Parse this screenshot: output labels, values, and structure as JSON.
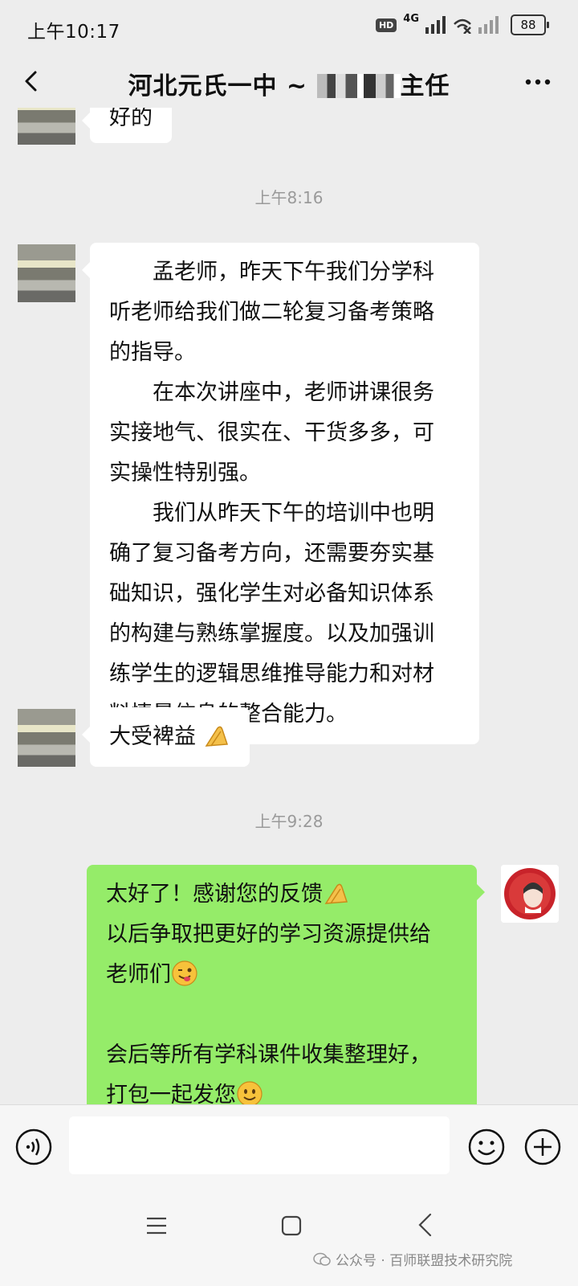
{
  "status_bar": {
    "time": "上午10:17",
    "hd": "HD",
    "network": "4G",
    "battery": "88"
  },
  "header": {
    "title_prefix": "河北元氏一中 ~",
    "title_suffix": "主任"
  },
  "messages": {
    "m0_text": "好的",
    "ts1": "上午8:16",
    "m1_p1": "　　孟老师，昨天下午我们分学科\n听老师给我们做二轮复习备考策略\n的指导。",
    "m1_p2": "　　在本次讲座中，老师讲课很务\n实接地气、很实在、干货多多，可\n实操性特别强。",
    "m1_p3": "　　我们从昨天下午的培训中也明\n确了复习备考方向，还需要夯实基\n础知识，强化学生对必备知识体系\n的构建与熟练掌握度。以及加强训\n练学生的逻辑思维推导能力和对材\n料情景信息的整合能力。",
    "m2_text": "大受裨益",
    "ts2": "上午9:28",
    "m3_l1": "太好了！感谢您的反馈",
    "m3_l2": "以后争取把更好的学习资源提供给",
    "m3_l3": "老师们",
    "m3_l4": "会后等所有学科课件收集整理好，",
    "m3_l5": "打包一起发您"
  },
  "input": {
    "value": ""
  },
  "watermark": "公众号 · 百师联盟技术研究院",
  "icons": {
    "back": "chevron-left-icon",
    "more": "more-dots-icon",
    "voice": "voice-icon",
    "emoji": "emoji-icon",
    "plus": "plus-icon"
  }
}
